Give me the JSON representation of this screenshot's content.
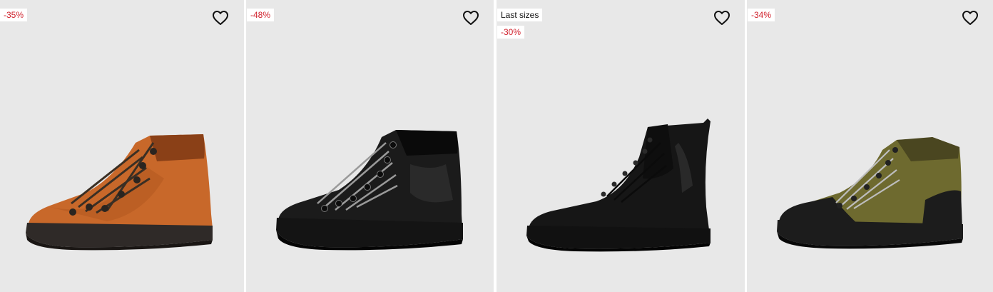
{
  "products": [
    {
      "badges": [
        {
          "type": "discount",
          "text": "-35%"
        }
      ],
      "image": {
        "icon": "hiking-boot-tan",
        "upper": "#c8682a",
        "dark": "#8a4017",
        "sole": "#2f2a28"
      }
    },
    {
      "badges": [
        {
          "type": "discount",
          "text": "-48%"
        }
      ],
      "image": {
        "icon": "hiking-boot-black",
        "upper": "#1b1b1b",
        "dark": "#000000",
        "sole": "#141414"
      }
    },
    {
      "badges": [
        {
          "type": "tag",
          "text": "Last sizes"
        },
        {
          "type": "discount",
          "text": "-30%"
        }
      ],
      "image": {
        "icon": "derby-boot-black",
        "upper": "#161616",
        "dark": "#000000",
        "sole": "#111111"
      }
    },
    {
      "badges": [
        {
          "type": "discount",
          "text": "-34%"
        }
      ],
      "image": {
        "icon": "hiking-boot-olive",
        "upper": "#6e6a2f",
        "dark": "#4a4620",
        "sole": "#1c1c1c"
      }
    }
  ],
  "icons": {
    "wishlist": "heart-outline-icon"
  },
  "colors": {
    "card_bg": "#e8e8e8",
    "discount_text": "#d0202b"
  }
}
